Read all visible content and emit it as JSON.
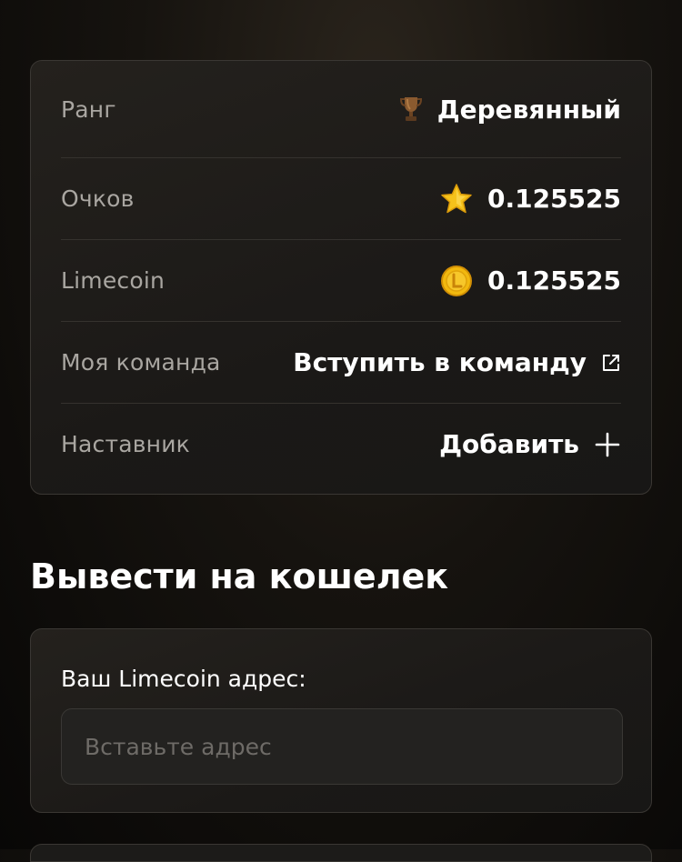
{
  "stats": {
    "rank": {
      "label": "Ранг",
      "value": "Деревянный",
      "icon": "trophy-icon"
    },
    "points": {
      "label": "Очков",
      "value": "0.125525",
      "icon": "star-icon"
    },
    "limecoin": {
      "label": "Limecoin",
      "value": "0.125525",
      "icon": "coin-icon"
    },
    "team": {
      "label": "Моя команда",
      "value": "Вступить в команду",
      "icon": "external-link-icon"
    },
    "mentor": {
      "label": "Наставник",
      "value": "Добавить",
      "icon": "plus-icon"
    }
  },
  "withdraw": {
    "title": "Вывести на кошелек",
    "address_label": "Ваш Limecoin адрес:",
    "address_placeholder": "Вставьте адрес",
    "address_value": ""
  },
  "colors": {
    "background": "#0b0a09",
    "card": "#1c1a18",
    "border": "#3a3733",
    "label": "#a9a6a1",
    "star": "#f5c21b",
    "coin": "#f2b90f",
    "trophy": "#8a5a2f"
  }
}
